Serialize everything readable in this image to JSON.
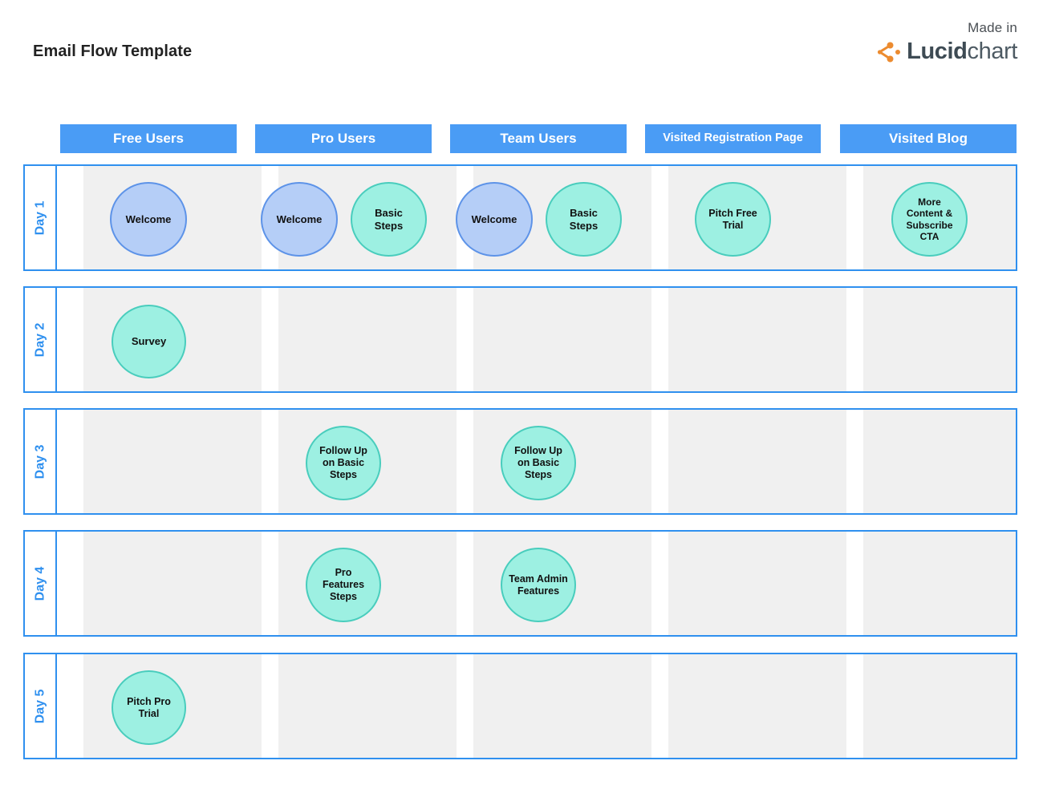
{
  "page": {
    "title": "Email Flow Template",
    "brand": {
      "made_in": "Made in",
      "word_bold": "Lucid",
      "word_light": "chart",
      "logo_icon": "lucidchart-logo-icon",
      "accent_color": "#ec8b2f"
    }
  },
  "theme": {
    "header_blue": "#4a9cf5",
    "lane_border_blue": "#2f90ef",
    "lane_fill_gray": "#f0f0f0",
    "teal_fill": "#9df0e2",
    "teal_border": "#49cdbd",
    "periwinkle_fill": "#b5cef7",
    "periwinkle_border": "#5d93e8",
    "title_color": "#222222"
  },
  "columns": [
    {
      "id": "free-users",
      "label": "Free Users",
      "size": "big"
    },
    {
      "id": "pro-users",
      "label": "Pro Users",
      "size": "big"
    },
    {
      "id": "team-users",
      "label": "Team Users",
      "size": "big"
    },
    {
      "id": "visited-reg",
      "label": "Visited  Registration Page",
      "size": "small"
    },
    {
      "id": "visited-blog",
      "label": "Visited Blog",
      "size": "big"
    }
  ],
  "rows": [
    {
      "id": "day-1",
      "label": "Day 1"
    },
    {
      "id": "day-2",
      "label": "Day 2"
    },
    {
      "id": "day-3",
      "label": "Day 3"
    },
    {
      "id": "day-4",
      "label": "Day 4"
    },
    {
      "id": "day-5",
      "label": "Day 5"
    }
  ],
  "nodes": [
    {
      "id": "n1",
      "row": "Day 1",
      "column": "Free Users",
      "label": "Welcome",
      "lines": [
        "Welcome"
      ],
      "style": "periwinkle"
    },
    {
      "id": "n2",
      "row": "Day 1",
      "column": "Pro Users",
      "label": "Welcome",
      "lines": [
        "Welcome"
      ],
      "style": "periwinkle"
    },
    {
      "id": "n3",
      "row": "Day 1",
      "column": "Pro Users",
      "label": "Basic Steps",
      "lines": [
        "Basic",
        "Steps"
      ],
      "style": "teal"
    },
    {
      "id": "n4",
      "row": "Day 1",
      "column": "Team Users",
      "label": "Welcome",
      "lines": [
        "Welcome"
      ],
      "style": "periwinkle"
    },
    {
      "id": "n5",
      "row": "Day 1",
      "column": "Team Users",
      "label": "Basic Steps",
      "lines": [
        "Basic",
        "Steps"
      ],
      "style": "teal"
    },
    {
      "id": "n6",
      "row": "Day 1",
      "column": "Visited  Registration Page",
      "label": "Pitch Free Trial",
      "lines": [
        "Pitch Free",
        "Trial"
      ],
      "style": "teal"
    },
    {
      "id": "n7",
      "row": "Day 1",
      "column": "Visited Blog",
      "label": "More Content & Subscribe CTA",
      "lines": [
        "More",
        "Content &",
        "Subscribe",
        "CTA"
      ],
      "style": "teal"
    },
    {
      "id": "n8",
      "row": "Day 2",
      "column": "Free Users",
      "label": "Survey",
      "lines": [
        "Survey"
      ],
      "style": "teal"
    },
    {
      "id": "n9",
      "row": "Day 3",
      "column": "Pro Users",
      "label": "Follow Up on Basic Steps",
      "lines": [
        "Follow Up",
        "on Basic",
        "Steps"
      ],
      "style": "teal"
    },
    {
      "id": "n10",
      "row": "Day 3",
      "column": "Team Users",
      "label": "Follow Up on Basic Steps",
      "lines": [
        "Follow Up",
        "on Basic",
        "Steps"
      ],
      "style": "teal"
    },
    {
      "id": "n11",
      "row": "Day 4",
      "column": "Pro Users",
      "label": "Pro Features Steps",
      "lines": [
        "Pro",
        "Features",
        "Steps"
      ],
      "style": "teal"
    },
    {
      "id": "n12",
      "row": "Day 4",
      "column": "Team Users",
      "label": "Team Admin Features",
      "lines": [
        "Team Admin",
        "Features"
      ],
      "style": "teal"
    },
    {
      "id": "n13",
      "row": "Day 5",
      "column": "Free Users",
      "label": "Pitch Pro Trial",
      "lines": [
        "Pitch Pro",
        "Trial"
      ],
      "style": "teal"
    }
  ]
}
